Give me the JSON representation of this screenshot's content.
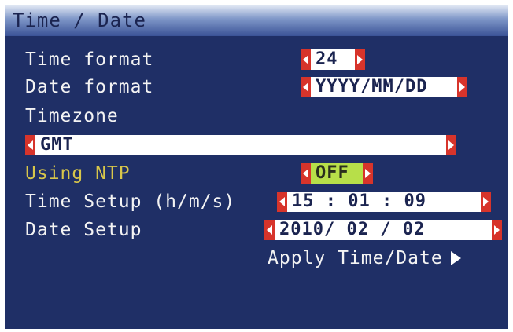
{
  "window": {
    "title": "Time / Date"
  },
  "settings": {
    "time_format": {
      "label": "Time format",
      "value": "24"
    },
    "date_format": {
      "label": "Date format",
      "value": "YYYY/MM/DD"
    },
    "timezone": {
      "label": "Timezone",
      "value": "GMT"
    },
    "ntp": {
      "label": "Using NTP",
      "value": "OFF"
    },
    "time_setup": {
      "label": "Time Setup (h/m/s)",
      "value": "15 : 01 : 09"
    },
    "date_setup": {
      "label": "Date Setup",
      "value": "2010/ 02 / 02"
    }
  },
  "actions": {
    "apply_label": "Apply Time/Date"
  },
  "colors": {
    "background": "#1f2f66",
    "accent_label": "#d8c64a",
    "spinner_arrow": "#d7342b",
    "ntp_value_bg": "#b7df49",
    "value_bg": "#ffffff"
  },
  "icons": {
    "spinner_left": "triangle-left-icon",
    "spinner_right": "triangle-right-icon",
    "apply": "play-arrow-icon"
  }
}
